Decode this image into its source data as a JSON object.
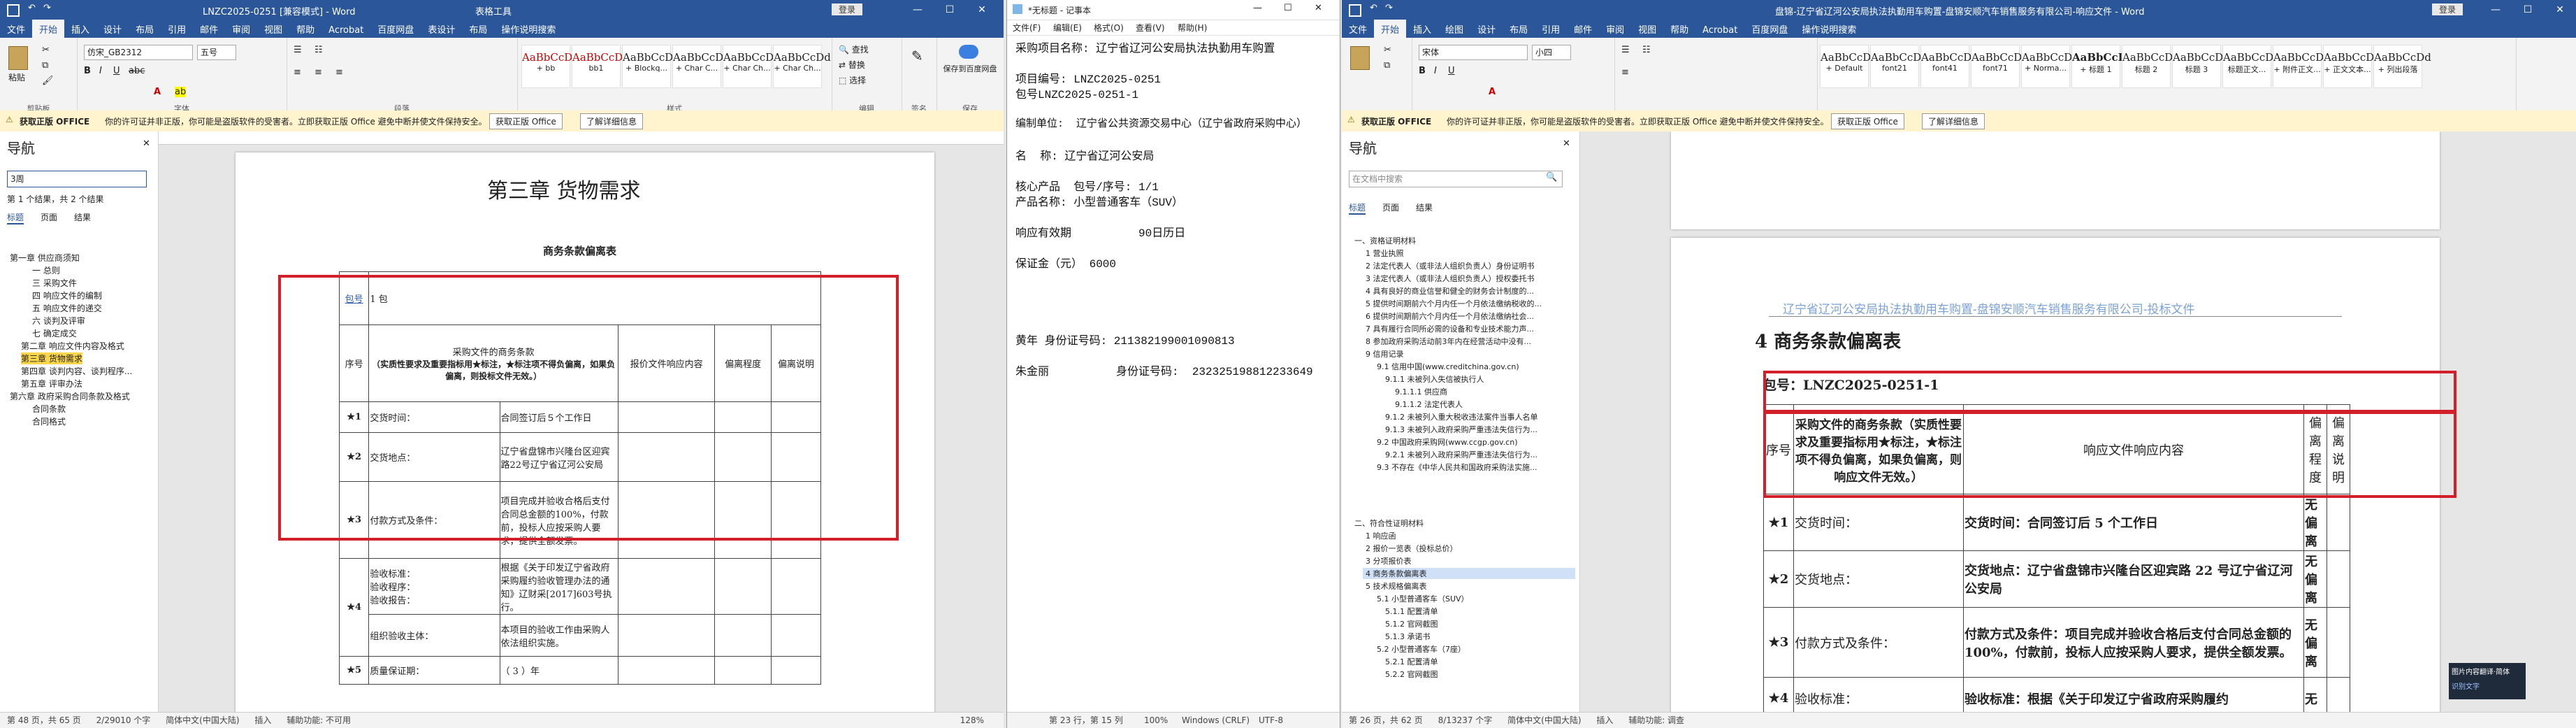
{
  "left_word": {
    "title": "LNZC2025-0251 [兼容模式] - Word",
    "tools_label": "表格工具",
    "login": "登录",
    "tabs": [
      "文件",
      "开始",
      "插入",
      "设计",
      "布局",
      "引用",
      "邮件",
      "审阅",
      "视图",
      "帮助",
      "Acrobat",
      "百度网盘",
      "表设计",
      "布局",
      "操作说明搜索"
    ],
    "active_tab": "开始",
    "clipboard": {
      "paste": "粘贴",
      "label": "剪贴板"
    },
    "font": {
      "name": "仿宋_GB2312",
      "size": "五号",
      "label": "字体"
    },
    "paragraph_label": "段落",
    "styles_label": "样式",
    "styles": [
      {
        "sample": "AaBbCcDd",
        "name": "+ bb"
      },
      {
        "sample": "AaBbCcDd",
        "name": "bb1"
      },
      {
        "sample": "AaBbCcDd",
        "name": "+ Blockq..."
      },
      {
        "sample": "AaBbCcDd",
        "name": "+ Char C..."
      },
      {
        "sample": "AaBbCcDd",
        "name": "+ Char Ch..."
      },
      {
        "sample": "AaBbCcDd",
        "name": "+ Char Ch..."
      }
    ],
    "editing": {
      "find": "查找",
      "replace": "替换",
      "select": "选择",
      "label": "编辑"
    },
    "sign": {
      "label": "签名"
    },
    "baidu": {
      "save": "保存到百度网盘",
      "label": "保存"
    },
    "infobar": {
      "brand": "获取正版 OFFICE",
      "text": "你的许可证并非正版，你可能是盗版软件的受害者。立即获取正版 Office 避免中断并使文件保持安全。",
      "btn1": "获取正版 Office",
      "btn2": "了解详细信息"
    },
    "nav": {
      "title": "导航",
      "search_value": "3周",
      "result": "第 1 个结果，共 2 个结果",
      "tabs": [
        "标题",
        "页面",
        "结果"
      ],
      "items": [
        "第一章 供应商须知",
        "一 总则",
        "三 采购文件",
        "四 响应文件的编制",
        "五 响应文件的递交",
        "六 谈判及评审",
        "七 确定成交",
        "第二章 响应文件内容及格式",
        "第三章 货物需求",
        "第四章 谈判内容、谈判程序...",
        "第五章 评审办法",
        "第六章 政府采购合同条款及格式",
        "合同条款",
        "合同格式"
      ]
    },
    "doc": {
      "chapter": "第三章  货物需求",
      "table_title": "商务条款偏离表",
      "pkg_head": "包号",
      "pkg": "1 包",
      "h_seq": "序号",
      "h_req": "采购文件的商务条款",
      "h_req_note": "（实质性要求及重要指标用★标注，★标注项不得负偏离，如果负偏离，则投标文件无效。）",
      "h_resp": "报价文件响应内容",
      "h_dev": "偏离程度",
      "h_note": "偏离说明",
      "rows": [
        {
          "seq": "★1",
          "item": "交货时间：",
          "content": "合同签订后５个工作日"
        },
        {
          "seq": "★2",
          "item": "交货地点：",
          "content": "辽宁省盘锦市兴隆台区迎宾路22号辽宁省辽河公安局"
        },
        {
          "seq": "★3",
          "item": "付款方式及条件：",
          "content": "项目完成并验收合格后支付合同总金额的100%，付款前，投标人应按采购人要求，提供全额发票。"
        },
        {
          "seq": "★4",
          "item": "验收标准：",
          "item2": "验收程序：",
          "item3": "验收报告：",
          "content": "根据《关于印发辽宁省政府采购履约验收管理办法的通知》辽财采[2017]603号执行。",
          "sub": "组织验收主体：",
          "sub_content": "本项目的验收工作由采购人依法组织实施。"
        },
        {
          "seq": "★5",
          "item": "质量保证期：",
          "content": "（ 3 ）年"
        }
      ]
    },
    "status": {
      "page": "第 48 页，共 65 页",
      "words": "2/29010 个字",
      "lang": "简体中文(中国大陆)",
      "insert": "插入",
      "focus": "辅助功能: 不可用",
      "zoom": "128%"
    }
  },
  "notepad": {
    "title": "*无标题 - 记事本",
    "menu": [
      "文件(F)",
      "编辑(E)",
      "格式(O)",
      "查看(V)",
      "帮助(H)"
    ],
    "lines": [
      "采购项目名称: 辽宁省辽河公安局执法执勤用车购置",
      "",
      "项目编号: LNZC2025-0251",
      "包号LNZC2025-0251-1",
      "",
      "编制单位:  辽宁省公共资源交易中心（辽宁省政府采购中心）",
      "",
      "名  称: 辽宁省辽河公安局",
      "",
      "核心产品  包号/序号: 1/1",
      "产品名称: 小型普通客车（SUV）",
      "",
      "响应有效期          90日历日",
      "",
      "保证金（元） 6000",
      "",
      "",
      "",
      "",
      "黄年 身份证号码: 211382199001090813",
      "",
      "朱金丽          身份证号码:  232325198812233649"
    ],
    "status": {
      "pos": "第 23 行，第 15 列",
      "zoom": "100%",
      "eol": "Windows (CRLF)",
      "enc": "UTF-8"
    }
  },
  "right_word": {
    "title": "盘锦-辽宁省辽河公安局执法执勤用车购置-盘锦安顺汽车销售服务有限公司-响应文件 - Word",
    "login": "登录",
    "tabs": [
      "文件",
      "开始",
      "插入",
      "绘图",
      "设计",
      "布局",
      "引用",
      "邮件",
      "审阅",
      "视图",
      "帮助",
      "Acrobat",
      "百度网盘",
      "操作说明搜索"
    ],
    "active_tab": "开始",
    "font": {
      "name": "宋体",
      "size": "小四"
    },
    "styles": [
      {
        "sample": "AaBbCcDd",
        "name": "+ Default"
      },
      {
        "sample": "AaBbCcDd",
        "name": "font21"
      },
      {
        "sample": "AaBbCcDd",
        "name": "font41"
      },
      {
        "sample": "AaBbCcDd",
        "name": "font71"
      },
      {
        "sample": "AaBbCcDd",
        "name": "+ Norma..."
      },
      {
        "sample": "AaBbCcDd",
        "name": "+ 标题 1"
      },
      {
        "sample": "AaBbCcDd",
        "name": "标题 2"
      },
      {
        "sample": "AaBbCcDd",
        "name": "标题 3"
      },
      {
        "sample": "AaBbCcDd",
        "name": "标题正文..."
      },
      {
        "sample": "AaBbCcDd",
        "name": "+ 附件正文..."
      },
      {
        "sample": "AaBbCcDd",
        "name": "+ 正文文本..."
      },
      {
        "sample": "AaBbCcDd",
        "name": "+ 列出段落"
      }
    ],
    "infobar": {
      "brand": "获取正版 OFFICE",
      "text": "你的许可证并非正版，你可能是盗版软件的受害者。立即获取正版 Office 避免中断并使文件保持安全。",
      "btn1": "获取正版 Office",
      "btn2": "了解详细信息"
    },
    "nav": {
      "title": "导航",
      "search_placeholder": "在文档中搜索",
      "tabs": [
        "标题",
        "页面",
        "结果"
      ],
      "items": [
        "一、资格证明材料",
        "1 营业执照",
        "2 法定代表人（或非法人组织负责人）身份证明书",
        "3 法定代表人（或非法人组织负责人）授权委托书",
        "4 具有良好的商业信誉和健全的财务会计制度的...",
        "5 提供时间期前六个月内任一个月依法缴纳税收的...",
        "6 提供时间期前六个月内任一个月依法缴纳社会...",
        "7 具有履行合同所必需的设备和专业技术能力声...",
        "8 参加政府采购活动前3年内在经营活动中没有...",
        "9 信用记录",
        "9.1 信用中国(www.creditchina.gov.cn)",
        "9.1.1 未被列入失信被执行人",
        "9.1.1.1 供应商",
        "9.1.1.2 法定代表人",
        "9.1.2 未被列入重大税收违法案件当事人名单",
        "9.1.3 未被列入政府采购严重违法失信行为...",
        "9.2 中国政府采购网(www.ccgp.gov.cn)",
        "9.2.1 未被列入政府采购严重违法失信行为...",
        "9.3 不存在《中华人民共和国政府采购法实施...",
        "二、符合性证明材料",
        "1 响应函",
        "2 报价一览表（投标总价）",
        "3 分项报价表",
        "4 商务条款偏离表",
        "5 技术规格偏离表",
        "5.1 小型普通客车（SUV）",
        "5.1.1 配置清单",
        "5.1.2 官网截图",
        "5.1.3 承诺书",
        "5.2 小型普通客车（7座）",
        "5.2.1 配置清单",
        "5.2.2 官网截图"
      ],
      "selected": "4 商务条款偏离表"
    },
    "doc": {
      "header": "辽宁省辽河公安局执法执勤用车购置-盘锦安顺汽车销售服务有限公司-投标文件",
      "heading": "4 商务条款偏离表",
      "pkg": "包号：LNZC2025-0251-1",
      "h_seq": "序号",
      "h_req": "采购文件的商务条款（实质性要求及重要指标用★标注，★标注项不得负偏离，如果负偏离，则响应文件无效。）",
      "h_resp": "响应文件响应内容",
      "h_dev": "偏离程度",
      "h_note": "偏离说明",
      "rows": [
        {
          "seq": "★1",
          "item": "交货时间：",
          "resp": "交货时间：合同签订后 5 个工作日",
          "dev": "无偏离"
        },
        {
          "seq": "★2",
          "item": "交货地点：",
          "resp": "交货地点：辽宁省盘锦市兴隆台区迎宾路 22 号辽宁省辽河公安局",
          "dev": "无偏离"
        },
        {
          "seq": "★3",
          "item": "付款方式及条件：",
          "resp": "付款方式及条件：项目完成并验收合格后支付合同总金额的 100%，付款前，投标人应按采购人要求，提供全额发票。",
          "dev": "无偏离"
        },
        {
          "seq": "★4",
          "item": "验收标准：",
          "resp": "验收标准：根据《关于印发辽宁省政府采购履约",
          "dev": "无"
        }
      ]
    },
    "status": {
      "page": "第 26 页，共 62 页",
      "words": "8/13237 个字",
      "lang": "简体中文(中国大陆)",
      "insert": "插入",
      "focus": "辅助功能: 调查"
    },
    "toast": {
      "line1": "图片内容翻译·简体",
      "line2": "识别文字"
    }
  }
}
